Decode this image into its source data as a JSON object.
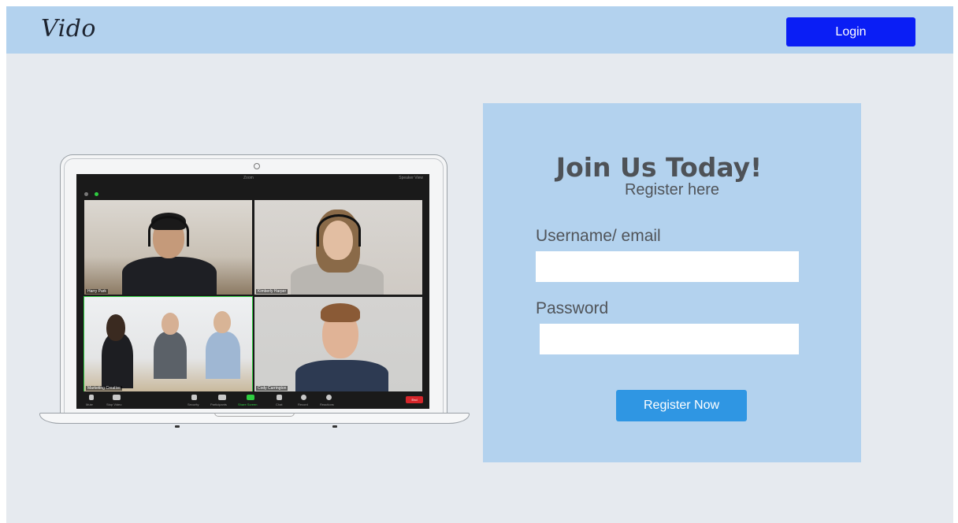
{
  "header": {
    "logo": "Vido",
    "login_label": "Login"
  },
  "illustration": {
    "app_title": "Zoom",
    "view_label": "Speaker View",
    "participants": [
      "Harry Park",
      "Kimberly Harper",
      "Marketing Creative",
      "Cody Carrington"
    ],
    "toolbar": [
      "Mute",
      "Stop Video",
      "Security",
      "Participants",
      "Share Screen",
      "Chat",
      "Record",
      "Reactions"
    ],
    "end_label": "End"
  },
  "register": {
    "heading": "Join Us Today!",
    "subheading": "Register here",
    "username_label": "Username/ email",
    "username_value": "",
    "password_label": "Password",
    "password_value": "",
    "submit_label": "Register Now"
  }
}
